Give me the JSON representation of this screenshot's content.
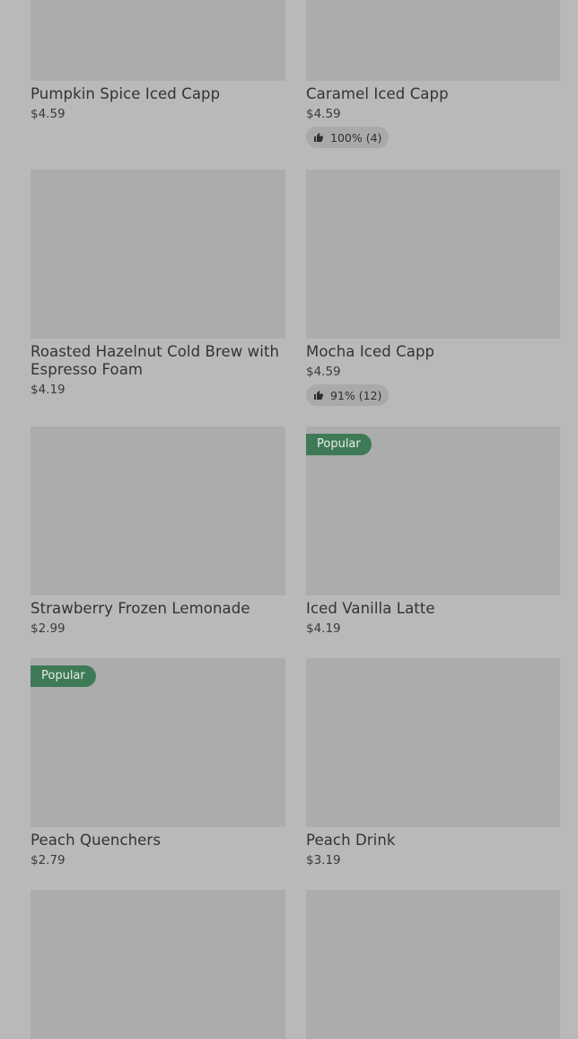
{
  "products": [
    {
      "name": "Pumpkin Spice Iced Capp",
      "price": "$4.59"
    },
    {
      "name": "Caramel Iced Capp",
      "price": "$4.59",
      "rating": "100% (4)"
    },
    {
      "name": "Roasted Hazelnut Cold Brew with Espresso Foam",
      "price": "$4.19"
    },
    {
      "name": "Mocha Iced Capp",
      "price": "$4.59",
      "rating": "91% (12)"
    },
    {
      "name": "Strawberry Frozen Lemonade",
      "price": "$2.99"
    },
    {
      "name": "Iced Vanilla Latte",
      "price": "$4.19",
      "badge": "Popular"
    },
    {
      "name": "Peach Quenchers",
      "price": "$2.79",
      "badge": "Popular"
    },
    {
      "name": "Peach Drink",
      "price": "$3.19"
    },
    {
      "name": "",
      "price": ""
    },
    {
      "name": "",
      "price": ""
    }
  ],
  "colors": {
    "background": "#b9b9b9",
    "image_placeholder": "#acacac",
    "badge": "#3f7a56",
    "rating_pill": "#a9a9a9"
  },
  "icons": {
    "rating": "thumbs-up-icon"
  }
}
